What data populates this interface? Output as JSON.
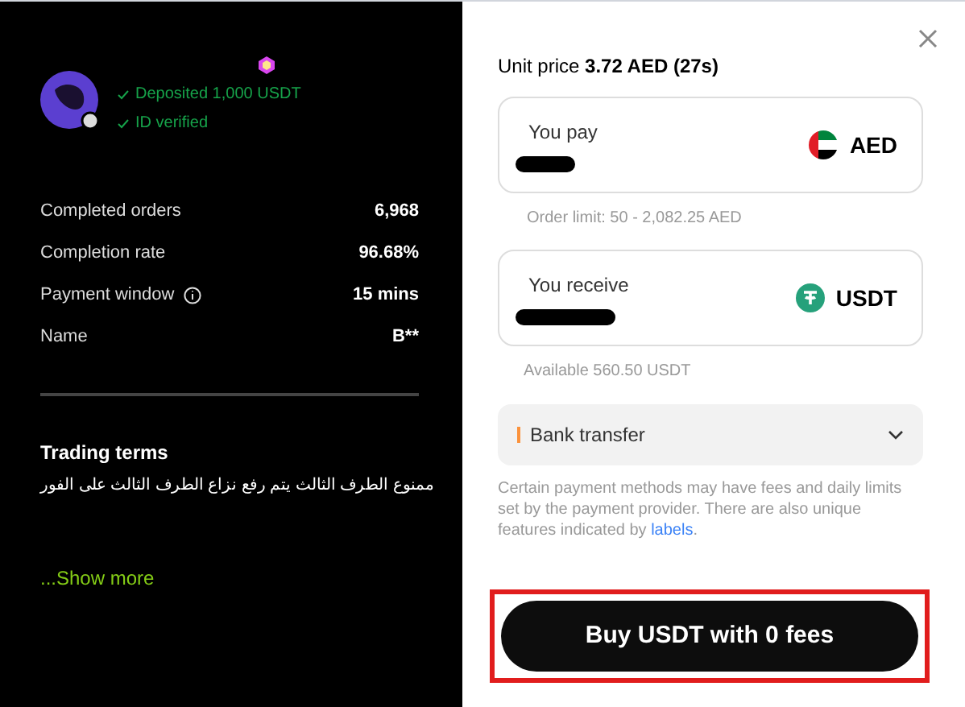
{
  "merchant": {
    "badges": [
      {
        "label": "Deposited 1,000 USDT"
      },
      {
        "label": "ID verified"
      }
    ],
    "stats": [
      {
        "label": "Completed orders",
        "value": "6,968",
        "info": false
      },
      {
        "label": "Completion rate",
        "value": "96.68%",
        "info": false
      },
      {
        "label": "Payment window",
        "value": "15 mins",
        "info": true
      },
      {
        "label": "Name",
        "value": "B**",
        "info": false
      }
    ],
    "terms_title": "Trading terms",
    "terms_text": "ممنوع الطرف الثالث يتم رفع نزاع الطرف الثالث على الفور",
    "show_more": "...Show more"
  },
  "order": {
    "unit_price_label": "Unit price",
    "unit_price": "3.72 AED (27s)",
    "fields": [
      {
        "label": "You pay",
        "currency": "AED",
        "kind": "aed",
        "hint": "Order limit: 50 - 2,082.25 AED"
      },
      {
        "label": "You receive",
        "currency": "USDT",
        "kind": "usdt",
        "hint": "Available 560.50 USDT"
      }
    ],
    "payment_method": "Bank transfer",
    "note": "Certain payment methods may have fees and daily limits set by the payment provider. There are also unique features indicated by ",
    "note_link": "labels",
    "note_end": ".",
    "button": {
      "label": "Buy USDT with 0 fees",
      "highlighted": true
    }
  }
}
